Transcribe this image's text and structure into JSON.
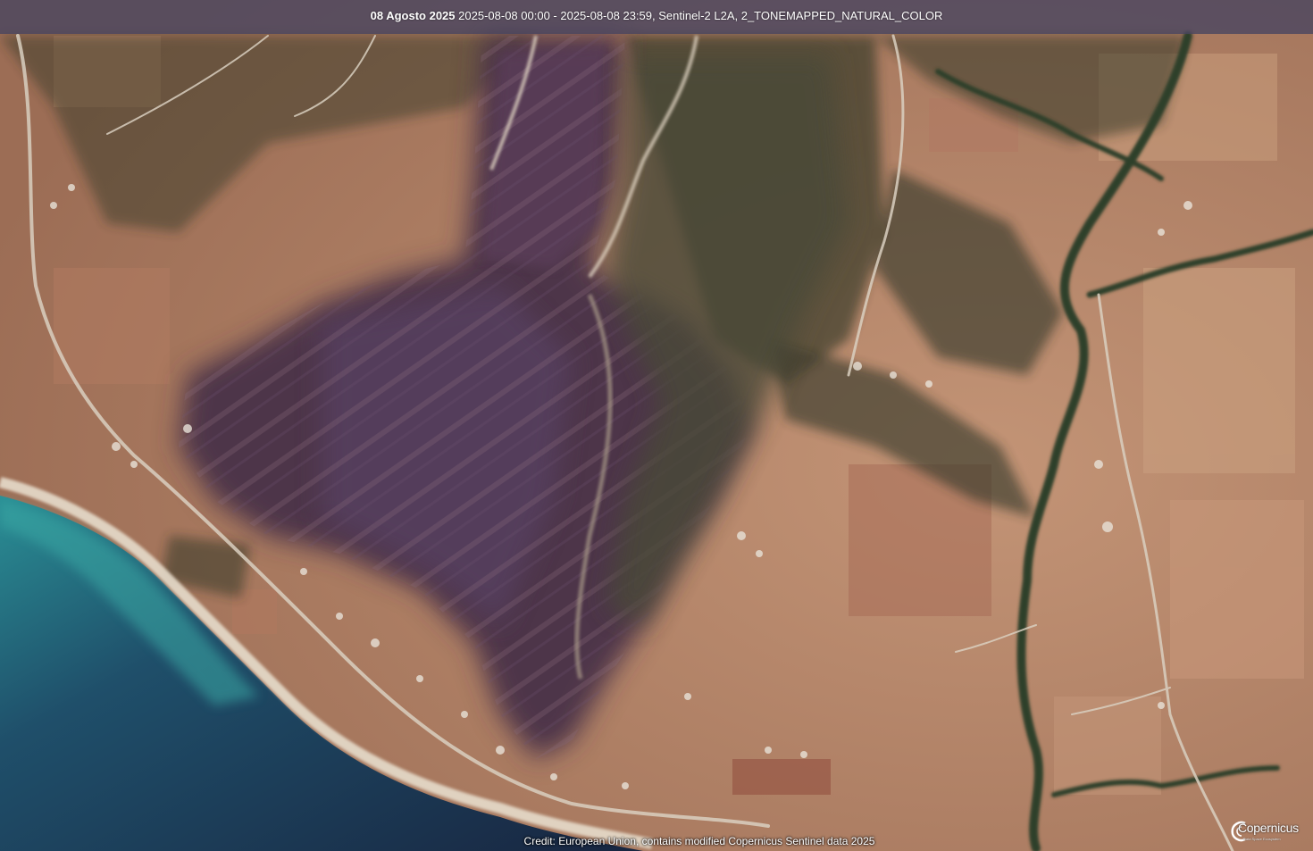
{
  "header": {
    "date_label": "08 Agosto 2025",
    "details": "2025-08-08 00:00 - 2025-08-08 23:59, Sentinel-2 L2A, 2_TONEMAPPED_NATURAL_COLOR"
  },
  "credit": "Credit: European Union, contains modified Copernicus Sentinel data 2025",
  "logo": {
    "text": "Copernicus",
    "subtext": "Data Space Ecosystem"
  },
  "colors": {
    "sea_deep": "#1b2a48",
    "sea_shallow": "#2e9c9a",
    "beach": "#e6dccb",
    "farmland": "#b88466",
    "burn_scar": "#4a3346",
    "vegetation": "#2f3a26",
    "road": "#d9cfc0"
  }
}
